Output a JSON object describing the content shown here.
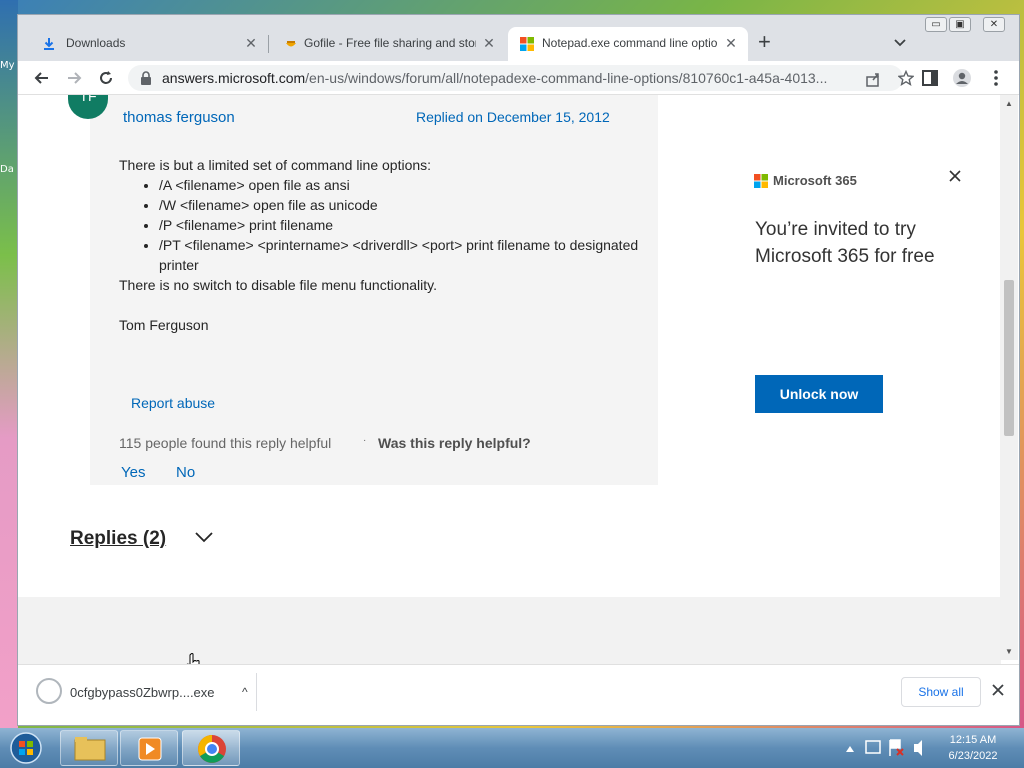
{
  "desktop": {
    "icon_labels": [
      "My",
      "Da"
    ]
  },
  "browser": {
    "tabs": [
      {
        "title": "Downloads",
        "close": "✕"
      },
      {
        "title": "Gofile - Free file sharing and stor",
        "close": "✕"
      },
      {
        "title": "Notepad.exe command line optio",
        "close": "✕"
      }
    ],
    "new_tab": "+",
    "url_host": "answers.microsoft.com",
    "url_path": "/en-us/windows/forum/all/notepadexe-command-line-options/810760c1-a45a-4013..."
  },
  "post": {
    "avatar_initials": "TF",
    "author": "thomas ferguson",
    "replied": "Replied on December 15, 2012",
    "intro": "There is but a limited set of command line options:",
    "options": [
      "/A <filename> open file as ansi",
      "/W <filename> open file as unicode",
      "/P <filename> print filename",
      "/PT <filename> <printername> <driverdll> <port> print filename to designated printer"
    ],
    "outro": "There is no switch to disable file menu functionality.",
    "signature": "Tom Ferguson",
    "report_abuse": "Report abuse",
    "helpful_count": "115 people found this reply helpful",
    "helpful_separator": "·",
    "helpful_question": "Was this reply helpful?",
    "yes": "Yes",
    "no": "No",
    "replies_label": "Replies (2)"
  },
  "ad": {
    "brand": "Microsoft 365",
    "title": "You’re invited to try Microsoft 365 for free",
    "button": "Unlock now"
  },
  "download_bar": {
    "file_name": "0cfgbypass0Zbwrp....exe",
    "chevron": "^",
    "show_all": "Show all"
  },
  "taskbar": {
    "time": "12:15 AM",
    "date": "6/23/2022"
  },
  "colors": {
    "link": "#0067b8",
    "avatar": "#107c63",
    "button": "#0067b8"
  }
}
